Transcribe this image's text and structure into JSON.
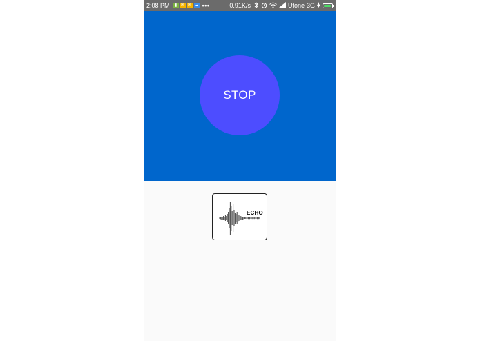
{
  "status_bar": {
    "time": "2:08 PM",
    "notifications": [
      {
        "icon": "battery-saver-icon",
        "color": "#7cb342"
      },
      {
        "icon": "app-notification-icon",
        "color": "#f5b400"
      },
      {
        "icon": "app-notification-icon",
        "color": "#f5b400"
      },
      {
        "icon": "cloud-icon",
        "color": "#3b8ce8"
      }
    ],
    "more": "•••",
    "speed": "0.91K/s",
    "icons": [
      "bluetooth-icon",
      "alarm-icon",
      "wifi-icon",
      "signal-icon"
    ],
    "carrier": "Ufone",
    "network": "3G",
    "battery_level": 0.9,
    "charging": true
  },
  "colors": {
    "status_bar_bg": "#6b6b6b",
    "top_panel_bg": "#0066cc",
    "stop_button_bg": "#4d4dff",
    "content_bg": "#fafafa"
  },
  "stop_button": {
    "label": "STOP"
  },
  "logo": {
    "text": "ECHO",
    "icon": "sound-wave-icon"
  }
}
